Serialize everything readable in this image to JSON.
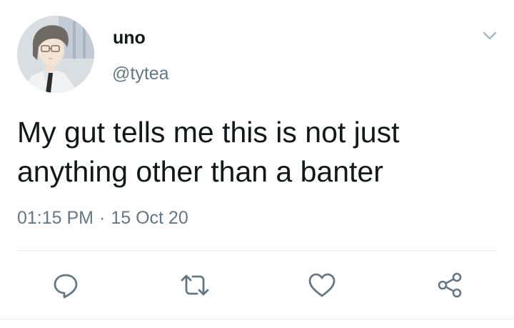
{
  "user": {
    "display_name": "uno",
    "handle": "@tytea"
  },
  "tweet": {
    "text_line1": "My gut tells me this is not just",
    "text_line2": "anything other than a banter",
    "time": "01:15 PM",
    "separator": "·",
    "date": "15 Oct 20"
  },
  "icons": {
    "menu": "chevron-down-icon",
    "reply": "reply-icon",
    "retweet": "retweet-icon",
    "like": "heart-icon",
    "share": "share-icon",
    "avatar": "anime-profile-picture"
  },
  "colors": {
    "text": "#14171a",
    "secondary": "#657786",
    "icon": "#657786",
    "divider": "#e1e8ed"
  }
}
